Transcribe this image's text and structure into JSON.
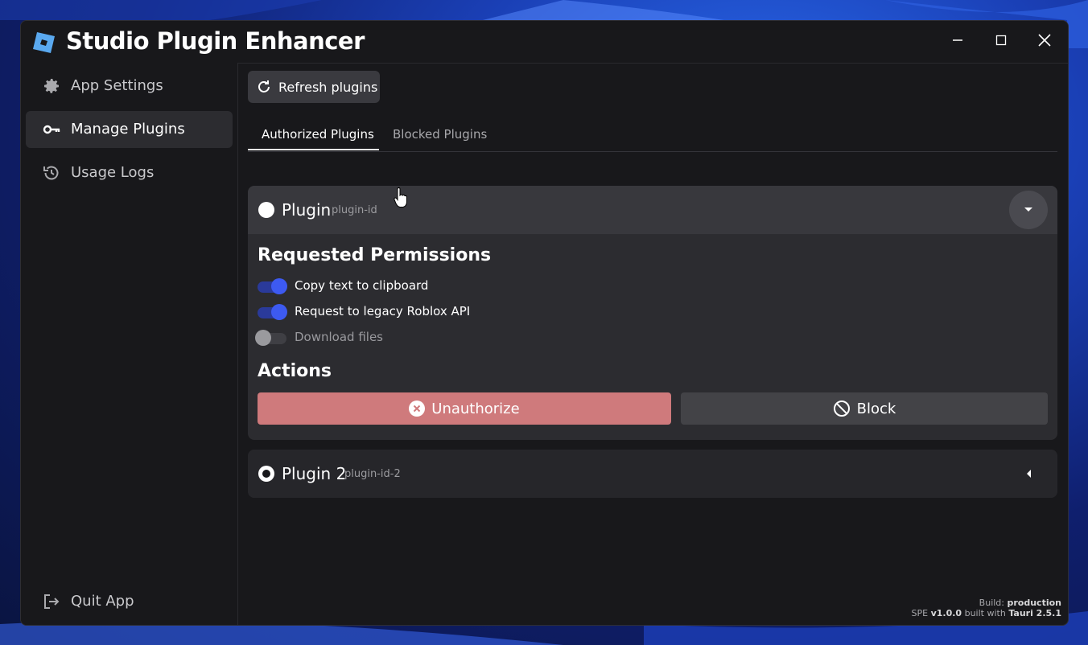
{
  "window": {
    "title": "Studio Plugin Enhancer",
    "controls": [
      "minimize",
      "maximize",
      "close"
    ]
  },
  "sidebar": {
    "items": [
      {
        "label": "App Settings",
        "icon": "gear-icon",
        "active": false
      },
      {
        "label": "Manage Plugins",
        "icon": "key-icon",
        "active": true
      },
      {
        "label": "Usage Logs",
        "icon": "history-icon",
        "active": false
      }
    ],
    "quit": {
      "label": "Quit App",
      "icon": "logout-icon"
    }
  },
  "toolbar": {
    "refresh_label": "Refresh plugins"
  },
  "tabs": [
    {
      "label": "Authorized Plugins",
      "active": true
    },
    {
      "label": "Blocked Plugins",
      "active": false
    }
  ],
  "plugins": [
    {
      "name": "Plugin",
      "id": "plugin-id",
      "expanded": true,
      "permissions_title": "Requested Permissions",
      "permissions": [
        {
          "label": "Copy text to clipboard",
          "enabled": true
        },
        {
          "label": "Request to legacy Roblox API",
          "enabled": true
        },
        {
          "label": "Download files",
          "enabled": false
        }
      ],
      "actions_title": "Actions",
      "actions": {
        "unauthorize_label": "Unauthorize",
        "block_label": "Block"
      }
    },
    {
      "name": "Plugin 2",
      "id": "plugin-id-2",
      "expanded": false
    }
  ],
  "footer": {
    "build_prefix": "Build:",
    "build_value": "production",
    "app_abbr": "SPE",
    "version": "v1.0.0",
    "built_with": "built with",
    "framework": "Tauri 2.5.1"
  },
  "colors": {
    "accent": "#3d5af1",
    "toggle_track_on": "#2a3a9a",
    "unauthorize_bg": "#cf7a7c",
    "block_bg": "#434347",
    "window_bg": "#18181b",
    "card_bg": "#2c2c30"
  }
}
